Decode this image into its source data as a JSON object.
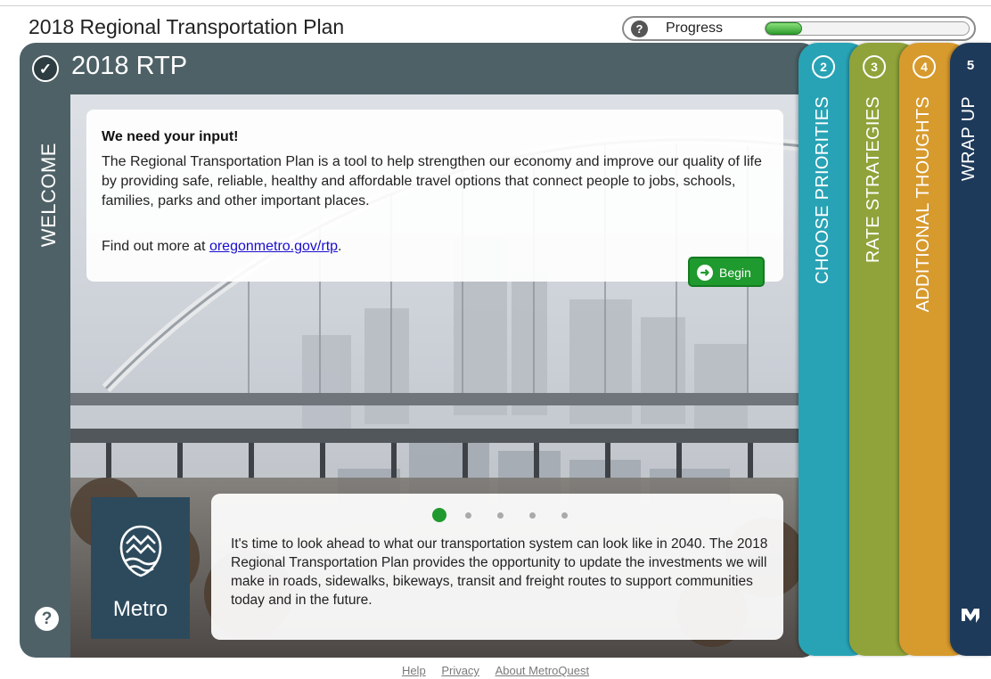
{
  "app": {
    "title": "2018 Regional Transportation Plan"
  },
  "progress": {
    "label": "Progress",
    "value": 0.18
  },
  "panel": {
    "title": "2018 RTP",
    "section_label": "WELCOME"
  },
  "intro": {
    "heading": "We need your input!",
    "body": "The Regional Transportation Plan is a tool to help strengthen our economy and improve our quality of life by providing safe, reliable, healthy and affordable travel options that connect people to jobs, schools, families, parks and other important places.",
    "more_prefix": "Find out more at ",
    "more_link": "oregonmetro.gov/rtp",
    "more_suffix": ".",
    "begin_label": "Begin"
  },
  "slide": {
    "dot_count": 5,
    "active_dot": 0,
    "text": "It's time to look ahead to what our transportation system can look like in 2040. The 2018 Regional Transportation Plan provides the opportunity to update the investments we will make in roads, sidewalks, bikeways, transit and freight routes to support communities today and in the future."
  },
  "logo": {
    "name": "Metro"
  },
  "tabs": [
    {
      "num": "2",
      "label": "CHOOSE PRIORITIES",
      "color": "#28a3b5"
    },
    {
      "num": "3",
      "label": "RATE STRATEGIES",
      "color": "#8fa33a"
    },
    {
      "num": "4",
      "label": "ADDITIONAL THOUGHTS",
      "color": "#d79a2d"
    },
    {
      "num": "5",
      "label": "WRAP UP",
      "color": "#1e3a5a"
    }
  ],
  "footer": {
    "links": [
      "Help",
      "Privacy",
      "About MetroQuest"
    ]
  }
}
